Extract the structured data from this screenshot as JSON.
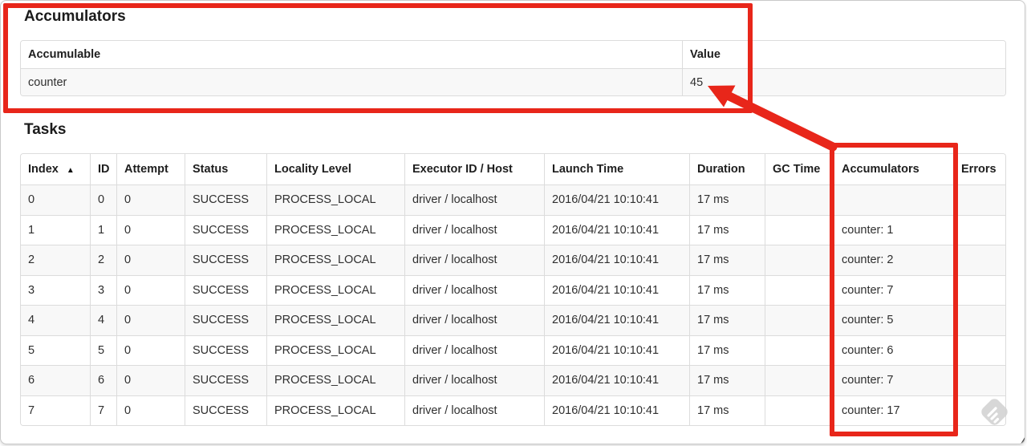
{
  "accumulators_section": {
    "title": "Accumulators",
    "table": {
      "headers": [
        "Accumulable",
        "Value"
      ],
      "rows": [
        [
          "counter",
          "45"
        ]
      ]
    }
  },
  "tasks_section": {
    "title": "Tasks",
    "table": {
      "sort": {
        "column": "Index",
        "direction": "ascending",
        "indicator": "▲"
      },
      "headers": [
        "Index",
        "ID",
        "Attempt",
        "Status",
        "Locality Level",
        "Executor ID / Host",
        "Launch Time",
        "Duration",
        "GC Time",
        "Accumulators",
        "Errors"
      ],
      "rows": [
        [
          "0",
          "0",
          "0",
          "SUCCESS",
          "PROCESS_LOCAL",
          "driver / localhost",
          "2016/04/21 10:10:41",
          "17 ms",
          "",
          "",
          ""
        ],
        [
          "1",
          "1",
          "0",
          "SUCCESS",
          "PROCESS_LOCAL",
          "driver / localhost",
          "2016/04/21 10:10:41",
          "17 ms",
          "",
          "counter: 1",
          ""
        ],
        [
          "2",
          "2",
          "0",
          "SUCCESS",
          "PROCESS_LOCAL",
          "driver / localhost",
          "2016/04/21 10:10:41",
          "17 ms",
          "",
          "counter: 2",
          ""
        ],
        [
          "3",
          "3",
          "0",
          "SUCCESS",
          "PROCESS_LOCAL",
          "driver / localhost",
          "2016/04/21 10:10:41",
          "17 ms",
          "",
          "counter: 7",
          ""
        ],
        [
          "4",
          "4",
          "0",
          "SUCCESS",
          "PROCESS_LOCAL",
          "driver / localhost",
          "2016/04/21 10:10:41",
          "17 ms",
          "",
          "counter: 5",
          ""
        ],
        [
          "5",
          "5",
          "0",
          "SUCCESS",
          "PROCESS_LOCAL",
          "driver / localhost",
          "2016/04/21 10:10:41",
          "17 ms",
          "",
          "counter: 6",
          ""
        ],
        [
          "6",
          "6",
          "0",
          "SUCCESS",
          "PROCESS_LOCAL",
          "driver / localhost",
          "2016/04/21 10:10:41",
          "17 ms",
          "",
          "counter: 7",
          ""
        ],
        [
          "7",
          "7",
          "0",
          "SUCCESS",
          "PROCESS_LOCAL",
          "driver / localhost",
          "2016/04/21 10:10:41",
          "17 ms",
          "",
          "counter: 17",
          ""
        ]
      ]
    }
  },
  "annotations": {
    "color": "#e8261a"
  }
}
